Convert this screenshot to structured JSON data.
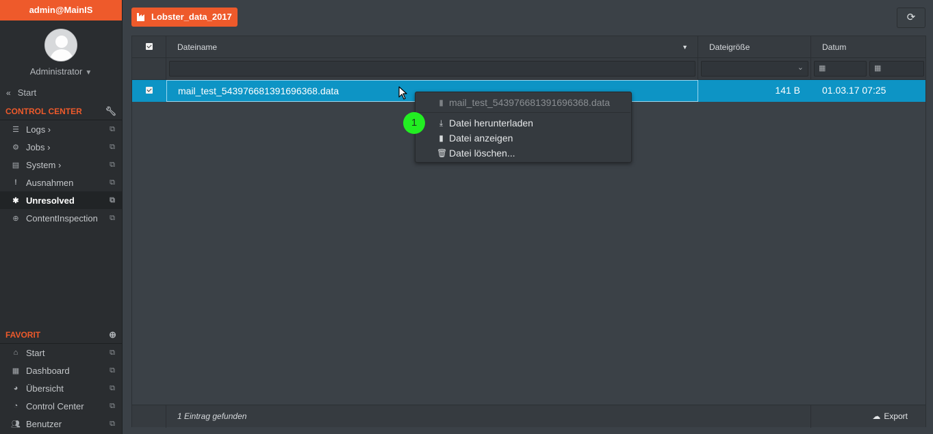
{
  "sidebar": {
    "header": "admin@MainIS",
    "user_role": "Administrator",
    "start_link": "Start",
    "control_center": {
      "title": "CONTROL CENTER",
      "icon": "wrench-icon",
      "items": [
        {
          "label": "Logs ›",
          "icon": "list-icon"
        },
        {
          "label": "Jobs ›",
          "icon": "sliders-icon"
        },
        {
          "label": "System ›",
          "icon": "server-icon"
        },
        {
          "label": "Ausnahmen",
          "icon": "exclamation-icon"
        },
        {
          "label": "Unresolved",
          "icon": "asterisk-icon"
        },
        {
          "label": "ContentInspection",
          "icon": "search-plus-icon"
        }
      ]
    },
    "favorites": {
      "title": "FAVORIT",
      "icon": "plus-circle-icon",
      "items": [
        {
          "label": "Start",
          "icon": "home-icon"
        },
        {
          "label": "Dashboard",
          "icon": "th-large-icon"
        },
        {
          "label": "Übersicht",
          "icon": "pie-chart-icon"
        },
        {
          "label": "Control Center",
          "icon": "tachometer-icon"
        },
        {
          "label": "Benutzer",
          "icon": "users-icon"
        }
      ]
    }
  },
  "toolbar": {
    "project_label": "Lobster_data_2017"
  },
  "grid": {
    "columns": {
      "name": "Dateiname",
      "size": "Dateigröße",
      "date": "Datum"
    },
    "rows": [
      {
        "name": "mail_test_543976681391696368.data",
        "size": "141 B",
        "date": "01.03.17 07:25"
      }
    ],
    "footer_count": "1 Eintrag gefunden",
    "export_label": "Export"
  },
  "context_menu": {
    "title": "mail_test_543976681391696368.data",
    "items": [
      {
        "label": "Datei herunterladen",
        "icon": "download-icon"
      },
      {
        "label": "Datei anzeigen",
        "icon": "file-icon"
      },
      {
        "label": "Datei löschen...",
        "icon": "trash-icon"
      }
    ]
  },
  "annotation": {
    "badge": "1",
    "color": "#22ee22"
  },
  "colors": {
    "accent": "#ee5a2b",
    "selected_row": "#0d94c5",
    "background": "#3b4147",
    "sidebar": "#2a2d30"
  }
}
